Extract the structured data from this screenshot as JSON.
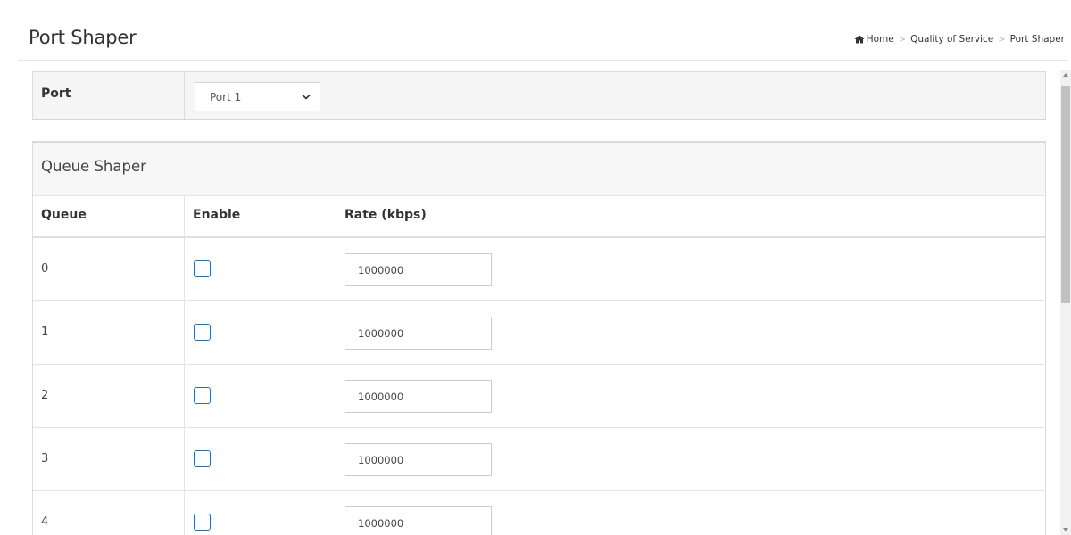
{
  "header": {
    "title": "Port Shaper",
    "breadcrumb": {
      "home": "Home",
      "section": "Quality of Service",
      "current": "Port Shaper",
      "separator": ">"
    }
  },
  "port": {
    "label": "Port",
    "selected": "Port 1"
  },
  "queue_shaper": {
    "title": "Queue Shaper",
    "columns": [
      "Queue",
      "Enable",
      "Rate (kbps)"
    ],
    "rows": [
      {
        "queue": "0",
        "enabled": false,
        "rate": "1000000"
      },
      {
        "queue": "1",
        "enabled": false,
        "rate": "1000000"
      },
      {
        "queue": "2",
        "enabled": false,
        "rate": "1000000"
      },
      {
        "queue": "3",
        "enabled": false,
        "rate": "1000000"
      },
      {
        "queue": "4",
        "enabled": false,
        "rate": "1000000"
      }
    ]
  },
  "colors": {
    "checkbox_border": "#2e6da4",
    "panel_bg": "#f5f5f5",
    "border": "#dcdcdc"
  },
  "icons": [
    "home-icon",
    "chevron-down-icon",
    "scroll-up-arrow-icon",
    "scroll-down-arrow-icon"
  ]
}
